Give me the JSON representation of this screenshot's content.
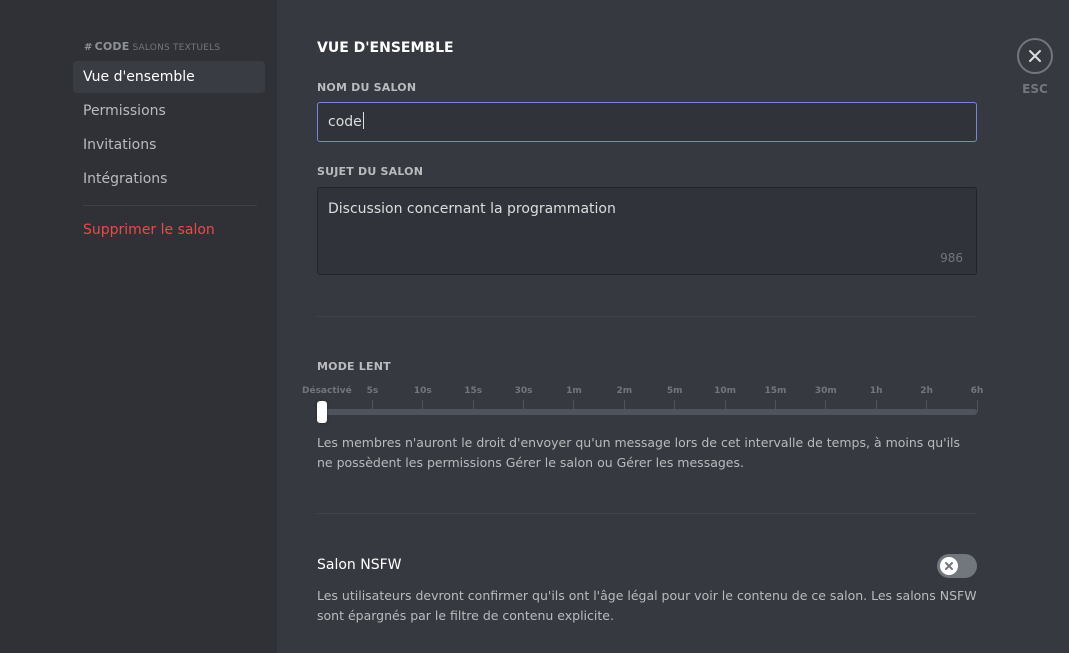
{
  "sidebar": {
    "channel_name": "CODE",
    "category": "SALONS TEXTUELS",
    "items": [
      {
        "label": "Vue d'ensemble"
      },
      {
        "label": "Permissions"
      },
      {
        "label": "Invitations"
      },
      {
        "label": "Intégrations"
      }
    ],
    "delete_label": "Supprimer le salon"
  },
  "main": {
    "title": "VUE D'ENSEMBLE",
    "channel_name_label": "NOM DU SALON",
    "channel_name_value": "code",
    "topic_label": "SUJET DU SALON",
    "topic_value": "Discussion concernant la programmation",
    "topic_counter": "986",
    "slowmode": {
      "label": "MODE LENT",
      "ticks": [
        "Désactivé",
        "5s",
        "10s",
        "15s",
        "30s",
        "1m",
        "2m",
        "5m",
        "10m",
        "15m",
        "30m",
        "1h",
        "2h",
        "6h"
      ],
      "selected_index": 0,
      "description": "Les membres n'auront le droit d'envoyer qu'un message lors de cet intervalle de temps, à moins qu'ils ne possèdent les permissions Gérer le salon ou Gérer les messages."
    },
    "nsfw": {
      "title": "Salon NSFW",
      "enabled": false,
      "description": "Les utilisateurs devront confirmer qu'ils ont l'âge légal pour voir le contenu de ce salon. Les salons NSFW sont épargnés par le filtre de contenu explicite."
    }
  },
  "close": {
    "esc_label": "ESC"
  },
  "colors": {
    "accent": "#7289da",
    "danger": "#f04747",
    "background": "#36393f",
    "sidebar": "#2f3136"
  }
}
